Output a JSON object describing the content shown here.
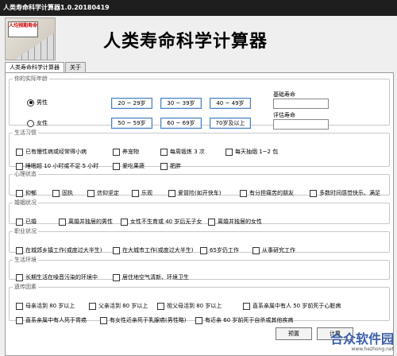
{
  "window": {
    "title": "人类寿命科学计算器1.0.20180419"
  },
  "header": {
    "title": "人类寿命科学计算器",
    "logo_text": "人均预期寿命"
  },
  "tabs": [
    {
      "label": "人类寿命科学计算器"
    },
    {
      "label": "关于"
    }
  ],
  "basic": {
    "legend": "你的实际年龄",
    "male": "男性",
    "female": "女性",
    "gender_selected": "男性",
    "ages": [
      "20 ~ 29岁",
      "30 ~ 39岁",
      "40 ~ 49岁",
      "50 ~ 59岁",
      "60 ~ 69岁",
      "70岁及以上"
    ],
    "base_life_label": "基础寿命",
    "base_life_value": "",
    "calc_life_label": "评估寿命",
    "calc_life_value": ""
  },
  "habits": {
    "legend": "生活习惯",
    "items": [
      "已有慢性病或经常得小病",
      "养宠物",
      "每周锻炼 3 次",
      "每天抽烟 1~2 包",
      "睡眠超 10 小时或不足 5 小时",
      "爱吃果蔬",
      "肥胖"
    ]
  },
  "mental": {
    "legend": "心理状态",
    "items": [
      "抑郁",
      "固执",
      "信仰坚定",
      "乐观",
      "爱冒险(如开快车)",
      "有分担痛苦的朋友",
      "多数时间感觉快乐、满足"
    ]
  },
  "marriage": {
    "legend": "婚姻状况",
    "items": [
      "已婚",
      "离婚并独居的男性",
      "女性不生育或 40 岁后无子女",
      "离婚并独居的女性"
    ]
  },
  "work": {
    "legend": "职业状况",
    "items": [
      "在城郊乡镇工作(或度过大半生)",
      "在大城市工作(或度过大半生)",
      "65岁仍工作",
      "从事研究工作"
    ]
  },
  "environment": {
    "legend": "生活环境",
    "items": [
      "长期生活在噪音污染的环境中",
      "居住地空气清新、环境卫生"
    ]
  },
  "genetics": {
    "legend": "遗传因素",
    "items": [
      "母亲活到 80 岁以上",
      "父亲活到 80 岁以上",
      "祖父母活到 80 岁以上",
      "直系亲属中有人 50 岁前死于心脏病",
      "直系亲属中有人死于胃癌",
      "有女性近亲死于乳腺癌(男性略)",
      "有近亲 60 岁前死于自杀或其他疾病"
    ]
  },
  "buttons": {
    "reset": "预置",
    "calc": "计算"
  },
  "watermark": {
    "text": "合众软件园",
    "url": "www.hezhong.net"
  }
}
